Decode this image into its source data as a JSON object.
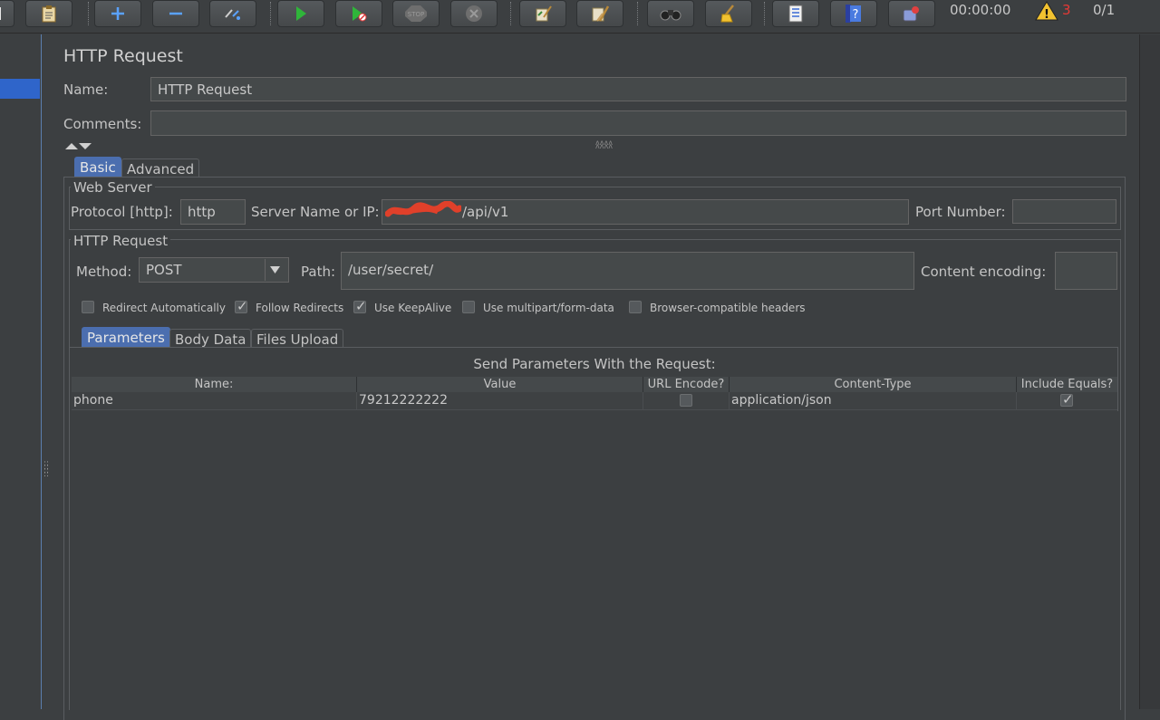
{
  "toolbar": {
    "timer": "00:00:00",
    "warnings_count": "3",
    "threads": "0/1"
  },
  "panel": {
    "title": "HTTP Request",
    "name_label": "Name:",
    "name_value": "HTTP Request",
    "comments_label": "Comments:",
    "comments_value": ""
  },
  "tabs": [
    {
      "label": "Basic",
      "active": true
    },
    {
      "label": "Advanced",
      "active": false
    }
  ],
  "web_server": {
    "title": "Web Server",
    "protocol_label": "Protocol [http]:",
    "protocol_value": "http",
    "server_label": "Server Name or IP:",
    "server_value": "/api/v1",
    "port_label": "Port Number:",
    "port_value": ""
  },
  "http_request": {
    "title": "HTTP Request",
    "method_label": "Method:",
    "method_value": "POST",
    "path_label": "Path:",
    "path_value": "/user/secret/",
    "encoding_label": "Content encoding:",
    "encoding_value": ""
  },
  "options": [
    {
      "label": "Redirect Automatically",
      "checked": false
    },
    {
      "label": "Follow Redirects",
      "checked": true
    },
    {
      "label": "Use KeepAlive",
      "checked": true
    },
    {
      "label": "Use multipart/form-data",
      "checked": false
    },
    {
      "label": "Browser-compatible headers",
      "checked": false
    }
  ],
  "sub_tabs": [
    {
      "label": "Parameters",
      "active": true
    },
    {
      "label": "Body Data",
      "active": false
    },
    {
      "label": "Files Upload",
      "active": false
    }
  ],
  "params": {
    "caption": "Send Parameters With the Request:",
    "columns": [
      "Name:",
      "Value",
      "URL Encode?",
      "Content-Type",
      "Include Equals?"
    ],
    "rows": [
      {
        "name": "phone",
        "value": "79212222222",
        "url_encode": false,
        "content_type": "application/json",
        "include_equals": true
      }
    ]
  },
  "colors": {
    "accent": "#4b6eaf",
    "selection": "#2f65ca",
    "warning": "#e53935",
    "redaction": "#e0402a"
  }
}
